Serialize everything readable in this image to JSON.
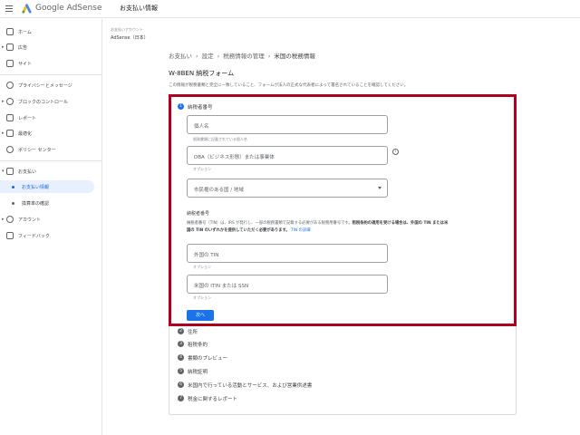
{
  "header": {
    "logo_text": "Google AdSense",
    "page_title": "お支払い情報"
  },
  "sidebar": {
    "items": [
      {
        "label": "ホーム",
        "icon": "home-icon"
      },
      {
        "label": "広告",
        "icon": "ads-icon"
      },
      {
        "label": "サイト",
        "icon": "sites-icon"
      },
      {
        "label": "プライバシーとメッセージ",
        "icon": "privacy-icon"
      },
      {
        "label": "ブロックのコントロール",
        "icon": "block-icon"
      },
      {
        "label": "レポート",
        "icon": "report-icon"
      },
      {
        "label": "最適化",
        "icon": "optimize-icon"
      },
      {
        "label": "ポリシー センター",
        "icon": "policy-icon"
      },
      {
        "label": "お支払い",
        "icon": "payments-icon"
      },
      {
        "label": "お支払い情報",
        "icon": "dot"
      },
      {
        "label": "換算率の確認",
        "icon": "dot"
      },
      {
        "label": "アカウント",
        "icon": "account-icon"
      },
      {
        "label": "フィードバック",
        "icon": "feedback-icon"
      }
    ]
  },
  "account": {
    "caption": "お支払いアカウント",
    "name": "AdSense（日本）"
  },
  "breadcrumb": [
    "お支払い",
    "設定",
    "税務情報の管理",
    "米国の税務情報"
  ],
  "form": {
    "title": "W-8BEN 納税フォーム",
    "description": "この情報が税務書類と完全に一致していること、フォームが法人の正式な代表者によって署名されていることを確認してください。",
    "step1_label": "納税者番号",
    "fields": {
      "name": {
        "placeholder": "個人名",
        "helper": "税務書類に記載されている個人名"
      },
      "dba": {
        "placeholder": "DBA（ビジネス形態）または事業体",
        "helper": "オプション"
      },
      "country": {
        "placeholder": "市民権のある国 / 地域"
      },
      "foreign_tin": {
        "placeholder": "外国の TIN",
        "helper": "オプション"
      },
      "us_tin": {
        "placeholder": "米国の ITIN または SSN",
        "helper": "オプション"
      }
    },
    "tin_heading": "納税者番号",
    "tin_text_1": "納税者番号（TIN）は、IRS が発行し、一部の税務書類で記載する必要がある税務用番号です。",
    "tin_text_bold_1": "租税条約の適用を受ける場合は、外国の TIN または米",
    "tin_text_bold_2": "国の TIN のいずれかを提供していただく必要があります。",
    "tin_link": "TIN の詳細",
    "next_button": "次へ"
  },
  "steps": [
    {
      "num": "1",
      "label": "納税者番号"
    },
    {
      "num": "2",
      "label": "住所"
    },
    {
      "num": "3",
      "label": "租税条約"
    },
    {
      "num": "4",
      "label": "書類のプレビュー"
    },
    {
      "num": "5",
      "label": "納税証明"
    },
    {
      "num": "6",
      "label": "米国内で行っている活動とサービス、および営業供述書"
    },
    {
      "num": "7",
      "label": "税金に関するレポート"
    }
  ],
  "colors": {
    "accent": "#1a73e8",
    "highlight_border": "#b00020",
    "active_nav_bg": "#e8f0fe"
  }
}
